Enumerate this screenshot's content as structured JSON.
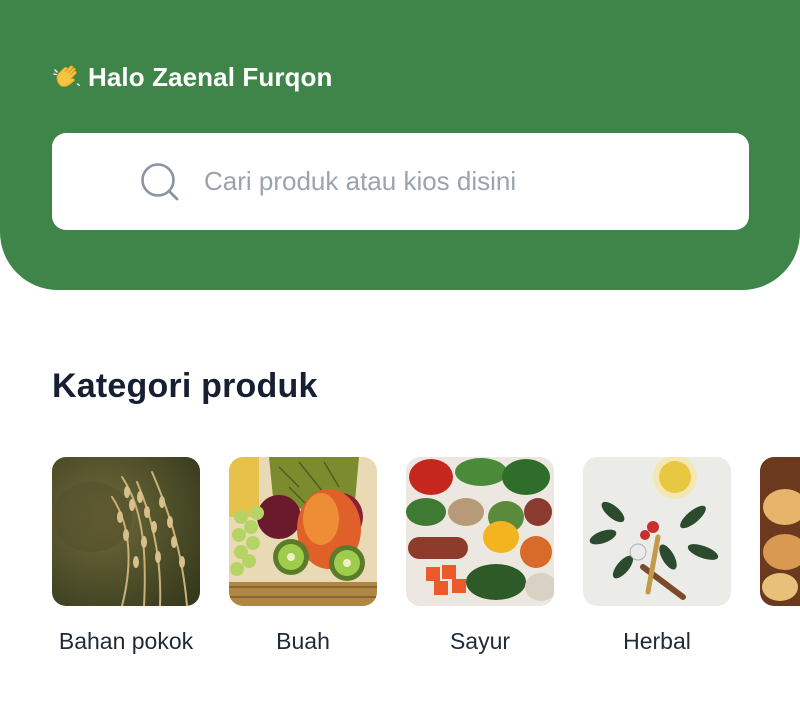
{
  "header": {
    "greeting": "Halo Zaenal Furqon",
    "wave_icon": "waving-hand-emoji",
    "bg_color": "#3f8449"
  },
  "search": {
    "placeholder": "Cari produk atau kios disini",
    "icon": "search-icon"
  },
  "categories_section": {
    "title": "Kategori produk",
    "items": [
      {
        "label": "Bahan pokok",
        "image": "rice-stalks"
      },
      {
        "label": "Buah",
        "image": "fruit-basket"
      },
      {
        "label": "Sayur",
        "image": "vegetables"
      },
      {
        "label": "Herbal",
        "image": "herbal-tea"
      },
      {
        "label": "",
        "image": "bread-partial"
      }
    ]
  }
}
